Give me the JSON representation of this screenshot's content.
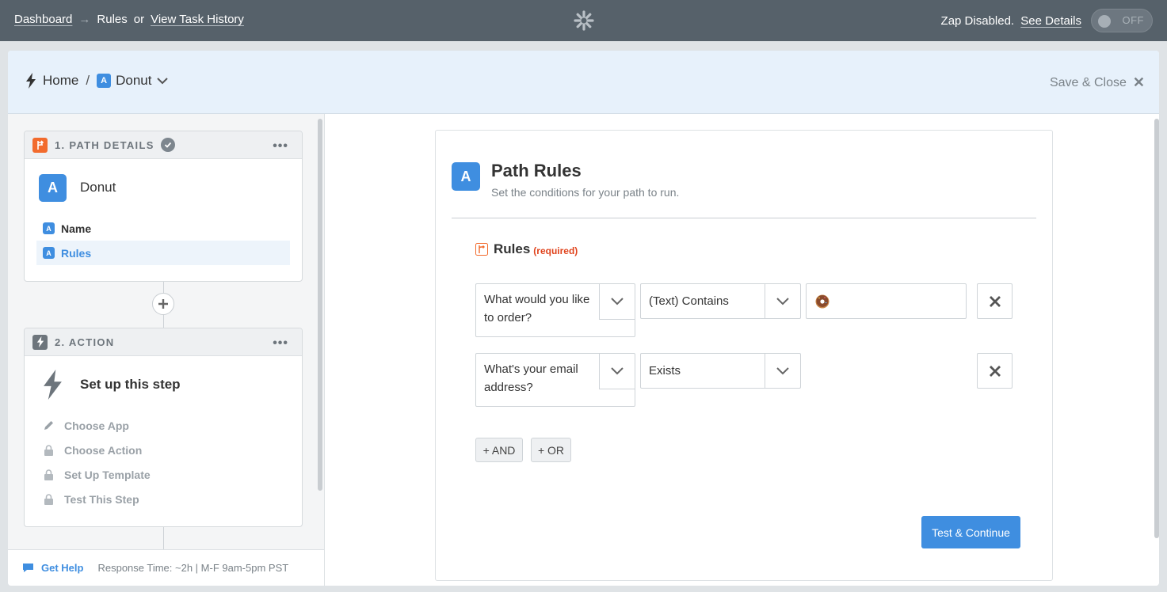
{
  "topbar": {
    "dashboard_link": "Dashboard",
    "arrow": "→",
    "current": "Rules",
    "or_text": "or",
    "task_history_link": "View Task History",
    "status_text": "Zap Disabled.",
    "see_details_link": "See Details",
    "toggle_label": "OFF",
    "logo_icon": "zapier-asterisk-icon"
  },
  "header": {
    "home": "Home",
    "slash": "/",
    "path_badge": "A",
    "path_name": "Donut",
    "save_close": "Save & Close",
    "close_glyph": "✕"
  },
  "sidebar": {
    "step1": {
      "heading": "1. PATH DETAILS",
      "badge": "A",
      "title": "Donut",
      "items": [
        {
          "badge": "A",
          "label": "Name"
        },
        {
          "badge": "A",
          "label": "Rules"
        }
      ]
    },
    "step2": {
      "heading": "2. ACTION",
      "title": "Set up this step",
      "items": [
        {
          "icon": "pencil-icon",
          "label": "Choose App"
        },
        {
          "icon": "lock-icon",
          "label": "Choose Action"
        },
        {
          "icon": "lock-icon",
          "label": "Set Up Template"
        },
        {
          "icon": "lock-icon",
          "label": "Test This Step"
        }
      ]
    },
    "help": {
      "link": "Get Help",
      "response": "Response Time: ~2h | M-F 9am-5pm PST"
    }
  },
  "main": {
    "badge": "A",
    "title": "Path Rules",
    "subtitle": "Set the conditions for your path to run.",
    "rules_label": "Rules",
    "required": "(required)",
    "rules": [
      {
        "field": "What would you like to order?",
        "condition": "(Text) Contains",
        "value": "donut-emoji"
      },
      {
        "field": "What's your email address?",
        "condition": "Exists",
        "value": ""
      }
    ],
    "and_button": "+ AND",
    "or_button": "+ OR",
    "primary_button": "Test & Continue"
  },
  "colors": {
    "topbar": "#56616a",
    "accent": "#3f8ee0",
    "header_bg": "#e7f1fb",
    "paths_orange": "#f26b2d",
    "required_red": "#e0431c"
  }
}
